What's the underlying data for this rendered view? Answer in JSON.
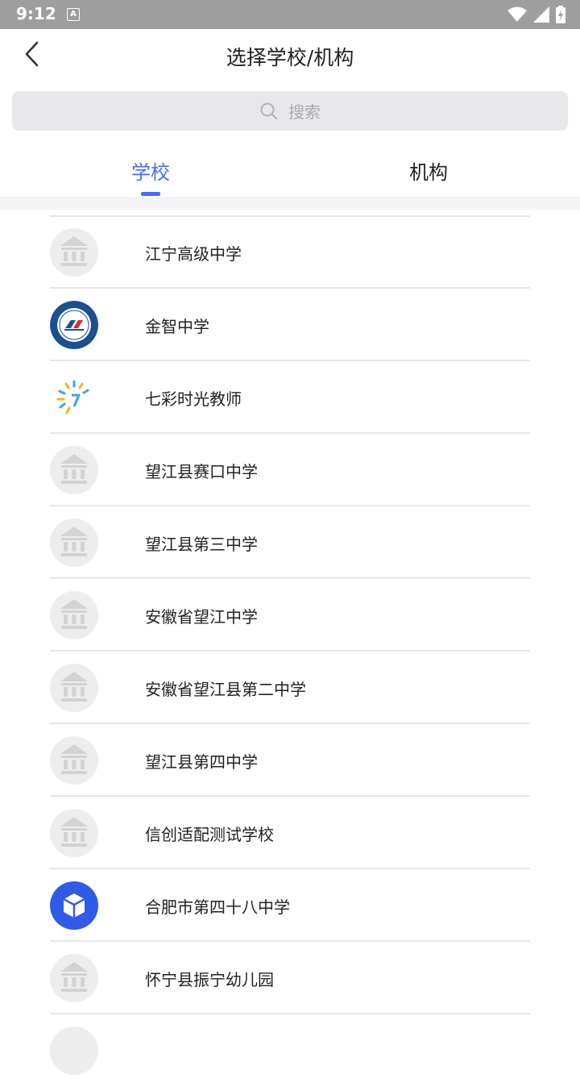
{
  "status_bar": {
    "time": "9:12",
    "notif_letter": "A"
  },
  "header": {
    "title": "选择学校/机构"
  },
  "search": {
    "placeholder": "搜索"
  },
  "tabs": [
    {
      "label": "学校",
      "active": true
    },
    {
      "label": "机构",
      "active": false
    }
  ],
  "colors": {
    "accent": "#4a6cf7"
  },
  "schools": [
    {
      "name": "江宁高级中学",
      "logo": "school-building-icon"
    },
    {
      "name": "金智中学",
      "logo": "jinzhi-logo"
    },
    {
      "name": "七彩时光教师",
      "logo": "qicai-logo"
    },
    {
      "name": "望江县赛口中学",
      "logo": "school-building-icon"
    },
    {
      "name": "望江县第三中学",
      "logo": "school-building-icon"
    },
    {
      "name": "安徽省望江中学",
      "logo": "school-building-icon"
    },
    {
      "name": "安徽省望江县第二中学",
      "logo": "school-building-icon"
    },
    {
      "name": "望江县第四中学",
      "logo": "school-building-icon"
    },
    {
      "name": "信创适配测试学校",
      "logo": "school-building-icon"
    },
    {
      "name": "合肥市第四十八中学",
      "logo": "cube-logo"
    },
    {
      "name": "怀宁县振宁幼儿园",
      "logo": "school-building-icon"
    }
  ]
}
